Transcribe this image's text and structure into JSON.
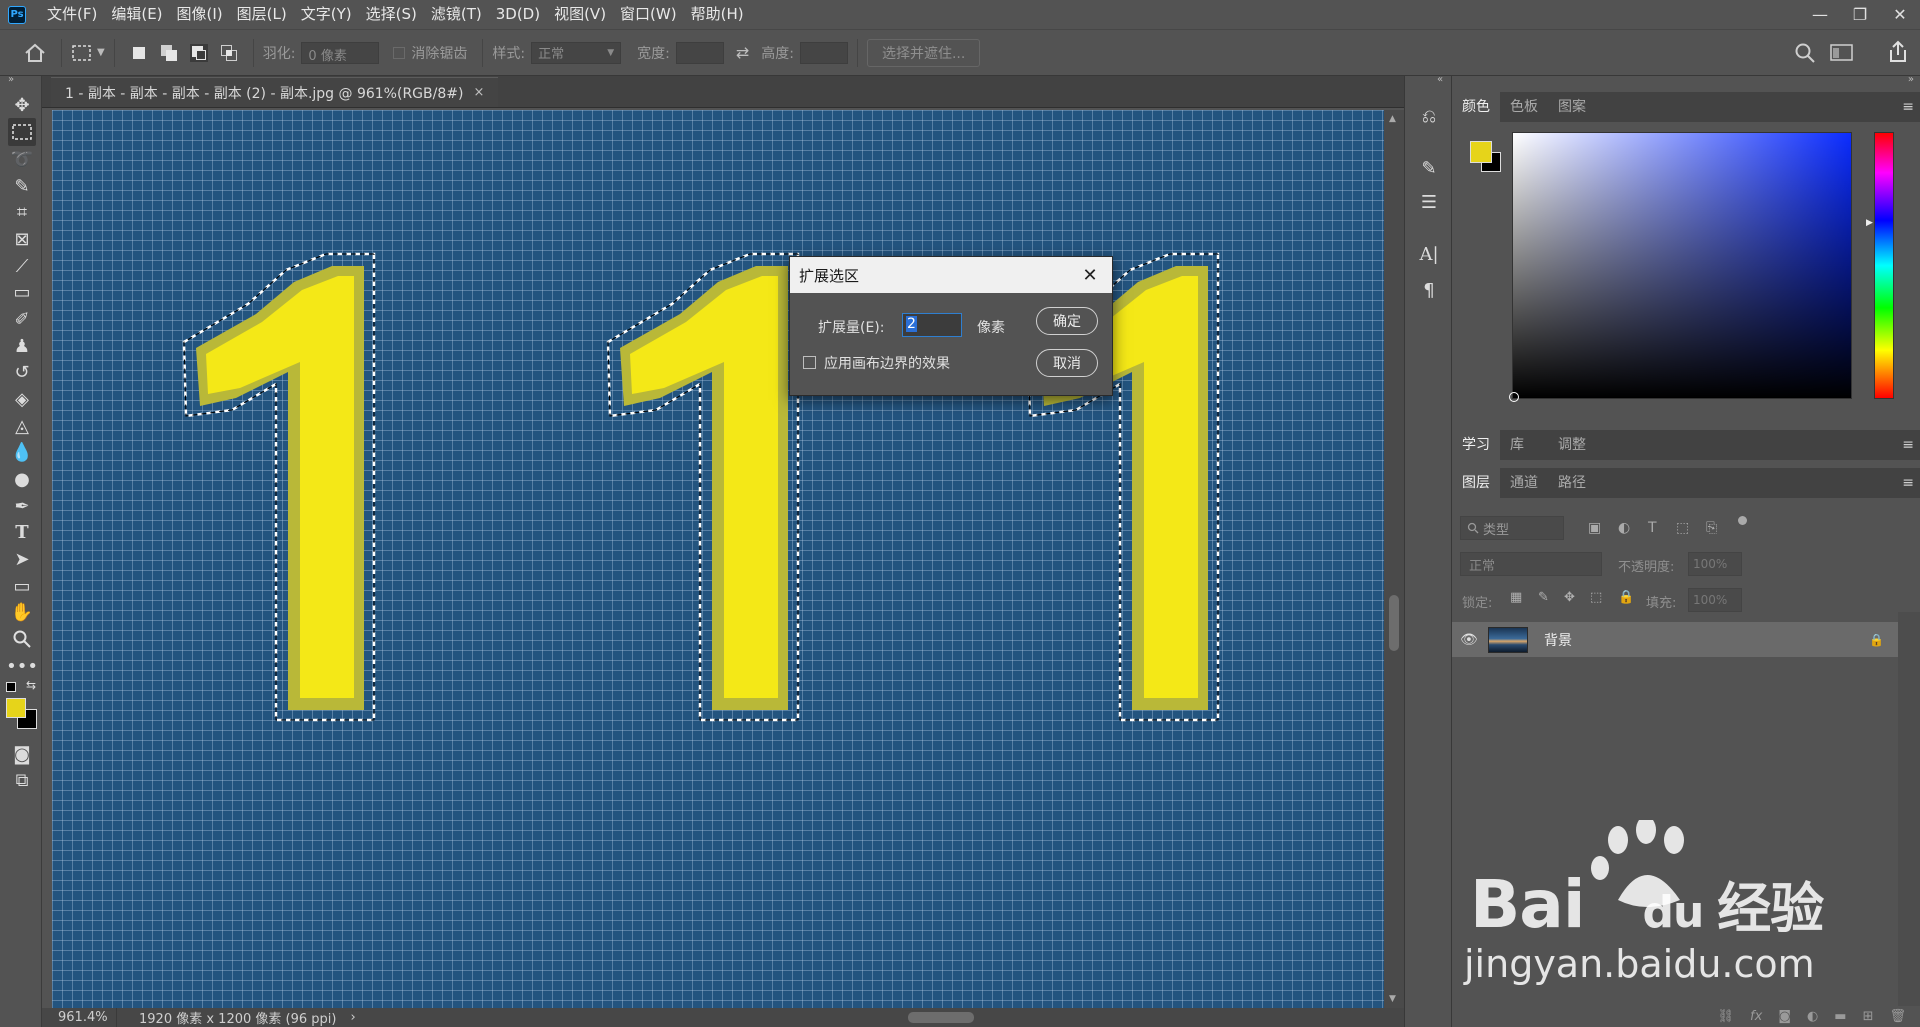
{
  "app": {
    "logo_text": "Ps"
  },
  "menu": [
    "文件(F)",
    "编辑(E)",
    "图像(I)",
    "图层(L)",
    "文字(Y)",
    "选择(S)",
    "滤镜(T)",
    "3D(D)",
    "视图(V)",
    "窗口(W)",
    "帮助(H)"
  ],
  "window_controls": {
    "minimize": "—",
    "restore": "❐",
    "close": "✕"
  },
  "options": {
    "feather_label": "羽化:",
    "feather_value": "0 像素",
    "antialias_label": "消除锯齿",
    "style_label": "样式:",
    "style_value": "正常",
    "width_label": "宽度:",
    "height_label": "高度:",
    "select_mask_button": "选择并遮住..."
  },
  "document": {
    "tab_title": "1 - 副本 - 副本 - 副本 - 副本 (2) - 副本.jpg @ 961%(RGB/8#)",
    "tab_close": "×"
  },
  "status": {
    "zoom": "961.4%",
    "doc_info": "1920 像素 x 1200 像素 (96 ppi)",
    "arrow": "›"
  },
  "dialog": {
    "title": "扩展选区",
    "expand_label": "扩展量(E):",
    "expand_value": "2",
    "unit": "像素",
    "apply_canvas_checkbox": "应用画布边界的效果",
    "ok_button": "确定",
    "cancel_button": "取消"
  },
  "color_panel": {
    "tabs": [
      "颜色",
      "色板",
      "图案"
    ],
    "foreground_color": "#e6d41a",
    "background_color": "#000000"
  },
  "learn_panel": {
    "tabs": [
      "学习",
      "库",
      "调整"
    ]
  },
  "layers_panel": {
    "tabs": [
      "图层",
      "通道",
      "路径"
    ],
    "filter_kind": "类型",
    "blend_mode": "正常",
    "opacity_label": "不透明度:",
    "opacity_value": "100%",
    "lock_label": "锁定:",
    "fill_label": "填充:",
    "fill_value": "100%",
    "layers": [
      {
        "name": "背景",
        "locked": true,
        "visible": true
      }
    ]
  },
  "watermark": {
    "brand": "Bai",
    "brand2": "du",
    "suffix": "经验",
    "url": "jingyan.baidu.com"
  },
  "colors": {
    "canvas_bg": "#23547f",
    "glyph_yellow": "#f4e817",
    "accent": "#31a8ff"
  }
}
